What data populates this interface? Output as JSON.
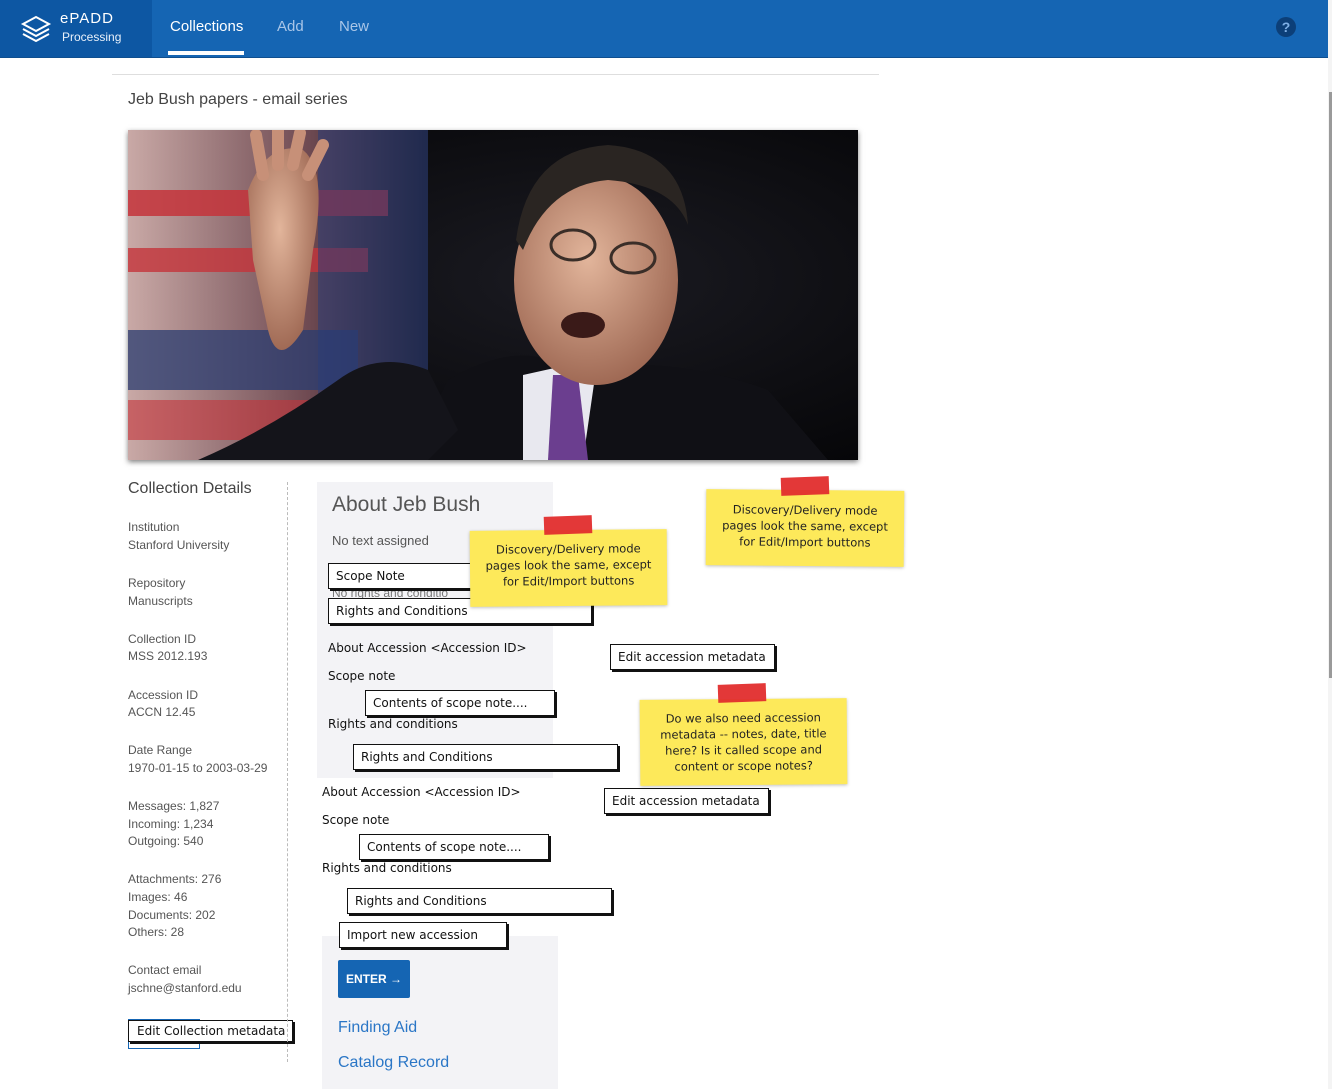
{
  "app": {
    "logo_title": "ePADD",
    "logo_subtitle": "Processing"
  },
  "nav": {
    "items": [
      {
        "label": "Collections",
        "active": true
      },
      {
        "label": "Add"
      },
      {
        "label": "New"
      }
    ]
  },
  "page": {
    "title": "Jeb Bush papers - email series"
  },
  "sidebar": {
    "title": "Collection Details",
    "institution_label": "Institution",
    "institution_value": "Stanford University",
    "repository_label": "Repository",
    "repository_value": "Manuscripts",
    "collection_id_label": "Collection ID",
    "collection_id_value": "MSS 2012.193",
    "accession_id_label": "Accession ID",
    "accession_id_value": "ACCN 12.45",
    "date_range_label": "Date Range",
    "date_range_value": "1970-01-15 to 2003-03-29",
    "messages": "Messages: 1,827",
    "incoming": "Incoming: 1,234",
    "outgoing": "Outgoing: 540",
    "attachments": "Attachments: 276",
    "images": "Images: 46",
    "documents": "Documents: 202",
    "others": "Others: 28",
    "contact_label": "Contact email",
    "contact_value": "jschne@stanford.edu",
    "edit_button": "Edit Collection metadata"
  },
  "about": {
    "title": "About Jeb Bush",
    "subtitle": "No text assigned",
    "scope_note_box": "Scope Note",
    "hidden_text": "No rights and conditio",
    "rights_box": "Rights and Conditions"
  },
  "accessions": [
    {
      "heading": "About Accession <Accession ID>",
      "scope_label": "Scope note",
      "scope_value": "Contents of scope note....",
      "rights_label": "Rights and conditions",
      "rights_value": "Rights and Conditions",
      "edit_button": "Edit accession metadata"
    },
    {
      "heading": "About Accession <Accession ID>",
      "scope_label": "Scope note",
      "scope_value": "Contents of scope note....",
      "rights_label": "Rights and conditions",
      "rights_value": "Rights and Conditions",
      "edit_button": "Edit accession metadata"
    }
  ],
  "import_button": "Import new accession",
  "enter_button": "ENTER",
  "links": {
    "finding_aid": "Finding Aid",
    "catalog_record": "Catalog Record"
  },
  "notes": {
    "note1": [
      "Discovery/Delivery mode",
      "pages look the same, except",
      "for Edit/Import buttons"
    ],
    "note2": [
      "Discovery/Delivery mode",
      "pages look the same, except",
      "for Edit/Import buttons"
    ],
    "note3": [
      "Do we also need accession",
      "metadata -- notes, date, title",
      "here? Is it called scope and",
      "content or scope notes?"
    ]
  },
  "colors": {
    "brand": "#1565b3",
    "note": "#fde95a",
    "tape": "#e22d2d",
    "link": "#2a76c6"
  }
}
